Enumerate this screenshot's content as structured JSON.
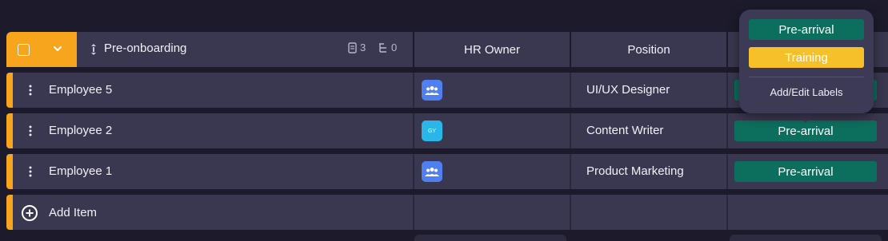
{
  "colors": {
    "accent": "#f7a51c",
    "pre_arrival": "#0c6e5c",
    "training": "#f6c02b",
    "owner_group": "#4f7ff0",
    "owner_gy": "#2ab6e8"
  },
  "header": {
    "group_title": "Pre-onboarding",
    "subitems_count": "3",
    "subtasks_count": "0",
    "columns": [
      "HR Owner",
      "Position",
      ""
    ]
  },
  "rows": [
    {
      "name": "Employee 5",
      "owner_icon": "people-group-icon",
      "owner_initials": "",
      "position": "UI/UX Designer",
      "label": ""
    },
    {
      "name": "Employee 2",
      "owner_icon": "avatar-initials",
      "owner_initials": "GY",
      "position": "Content Writer",
      "label": "Pre-arrival"
    },
    {
      "name": "Employee 1",
      "owner_icon": "people-group-icon",
      "owner_initials": "",
      "position": "Product Marketing",
      "label": "Pre-arrival"
    }
  ],
  "add_item": {
    "label": "Add Item"
  },
  "popup": {
    "options": [
      "Pre-arrival",
      "Training"
    ],
    "edit_label": "Add/Edit Labels"
  }
}
